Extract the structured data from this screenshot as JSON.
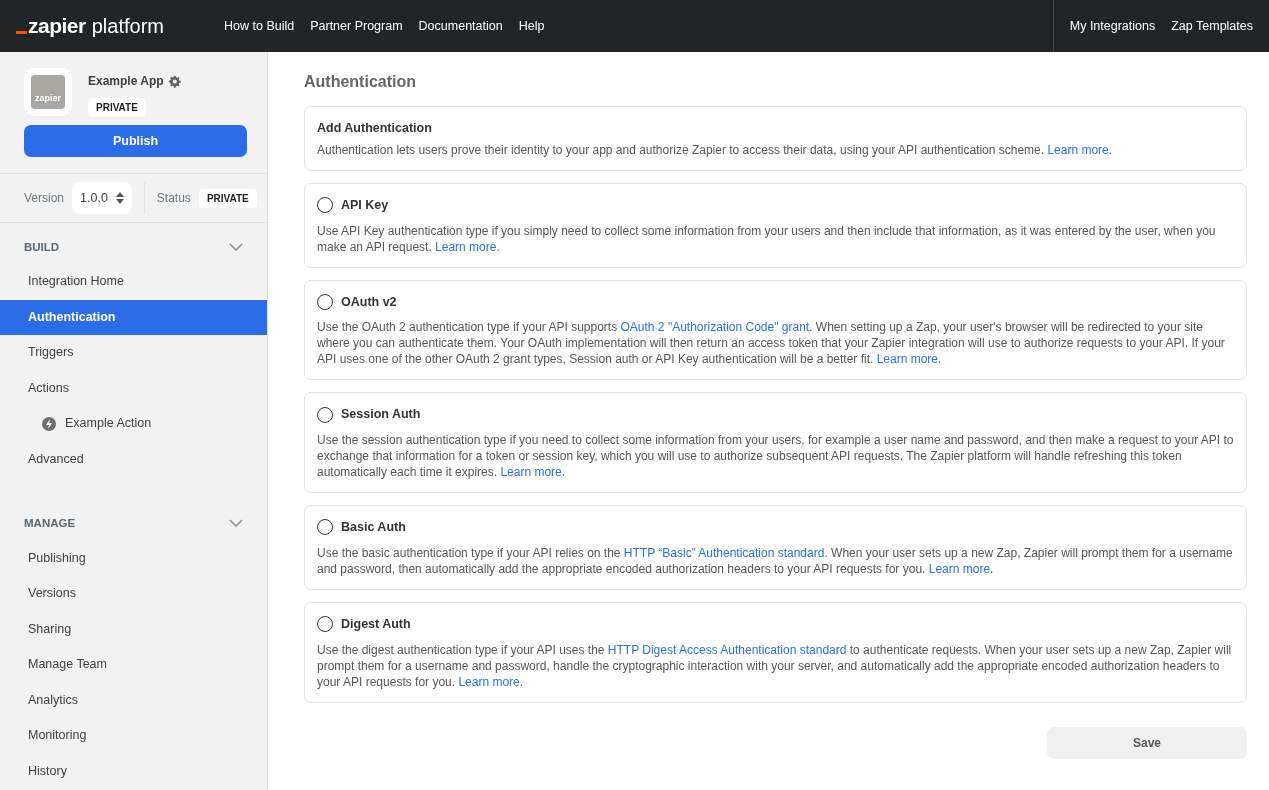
{
  "topbar": {
    "logo": {
      "brand": "zapier",
      "product": "platform"
    },
    "nav": [
      "How to Build",
      "Partner Program",
      "Documentation",
      "Help"
    ],
    "right_nav": [
      "My Integrations",
      "Zap Templates"
    ]
  },
  "app": {
    "icon_text": "zapier",
    "name": "Example App",
    "badge": "PRIVATE",
    "publish": "Publish",
    "version_label": "Version",
    "version": "1.0.0",
    "status_label": "Status",
    "status": "PRIVATE"
  },
  "sidebar": {
    "sections": [
      {
        "title": "BUILD",
        "expanded": true,
        "items": [
          {
            "label": "Integration Home",
            "selected": false
          },
          {
            "label": "Authentication",
            "selected": true
          },
          {
            "label": "Triggers",
            "selected": false
          },
          {
            "label": "Actions",
            "selected": false,
            "children": [
              {
                "label": "Example Action",
                "selected": false
              }
            ]
          },
          {
            "label": "Advanced",
            "selected": false
          }
        ]
      },
      {
        "title": "MANAGE",
        "expanded": true,
        "items": [
          {
            "label": "Publishing",
            "selected": false
          },
          {
            "label": "Versions",
            "selected": false
          },
          {
            "label": "Sharing",
            "selected": false
          },
          {
            "label": "Manage Team",
            "selected": false
          },
          {
            "label": "Analytics",
            "selected": false
          },
          {
            "label": "Monitoring",
            "selected": false
          },
          {
            "label": "History",
            "selected": false
          }
        ]
      }
    ]
  },
  "main": {
    "title": "Authentication",
    "intro": {
      "title": "Add Authentication",
      "text": [
        {
          "kind": "text",
          "text": "Authentication lets users prove their identity to your app and authorize Zapier to access their data, using your API authentication scheme. "
        },
        {
          "kind": "link",
          "text": "Learn more."
        }
      ]
    },
    "options": [
      {
        "label": "API Key",
        "selected": false,
        "text": [
          {
            "kind": "text",
            "text": "Use API Key authentication type if you simply need to collect some information from your users and then include that information, as it was entered by the user, when you make an API request. "
          },
          {
            "kind": "link",
            "text": "Learn more."
          }
        ]
      },
      {
        "label": "OAuth v2",
        "selected": false,
        "text": [
          {
            "kind": "text",
            "text": "Use the OAuth 2 authentication type if your API supports "
          },
          {
            "kind": "link",
            "text": "OAuth 2 \"Authorization Code\" grant"
          },
          {
            "kind": "text",
            "text": ". When setting up a Zap, your user's browser will be redirected to your site where you can authenticate them. Your OAuth implementation will then return an access token that your Zapier integration will use to authorize requests to your API. If your API uses one of the other OAuth 2 grant types, Session auth or API Key authentication will be a better fit. "
          },
          {
            "kind": "link",
            "text": "Learn more."
          }
        ]
      },
      {
        "label": "Session Auth",
        "selected": false,
        "text": [
          {
            "kind": "text",
            "text": "Use the session authentication type if you need to collect some information from your users, for example a user name and password, and then make a request to your API to exchange that information for a token or session key, which you will use to authorize subsequent API requests. The Zapier platform will handle refreshing this token automatically each time it expires. "
          },
          {
            "kind": "link",
            "text": "Learn more."
          }
        ]
      },
      {
        "label": "Basic Auth",
        "selected": false,
        "text": [
          {
            "kind": "text",
            "text": "Use the basic authentication type if your API relies on the "
          },
          {
            "kind": "link",
            "text": "HTTP “Basic” Authentication standard"
          },
          {
            "kind": "text",
            "text": ". When your user sets up a new Zap, Zapier will prompt them for a username and password, then automatically add the appropriate encoded authorization headers to your API requests for you. "
          },
          {
            "kind": "link",
            "text": "Learn more."
          }
        ]
      },
      {
        "label": "Digest Auth",
        "selected": false,
        "text": [
          {
            "kind": "text",
            "text": "Use the digest authentication type if your API uses the "
          },
          {
            "kind": "link",
            "text": "HTTP Digest Access Authentication standard"
          },
          {
            "kind": "text",
            "text": " to authenticate requests. When your user sets up a new Zap, Zapier will prompt them for a username and password, handle the cryptographic interaction with your server, and automatically add the appropriate encoded authorization headers to your API requests for you. "
          },
          {
            "kind": "link",
            "text": "Learn more."
          }
        ]
      }
    ],
    "save": {
      "label": "Save",
      "disabled": true
    }
  }
}
